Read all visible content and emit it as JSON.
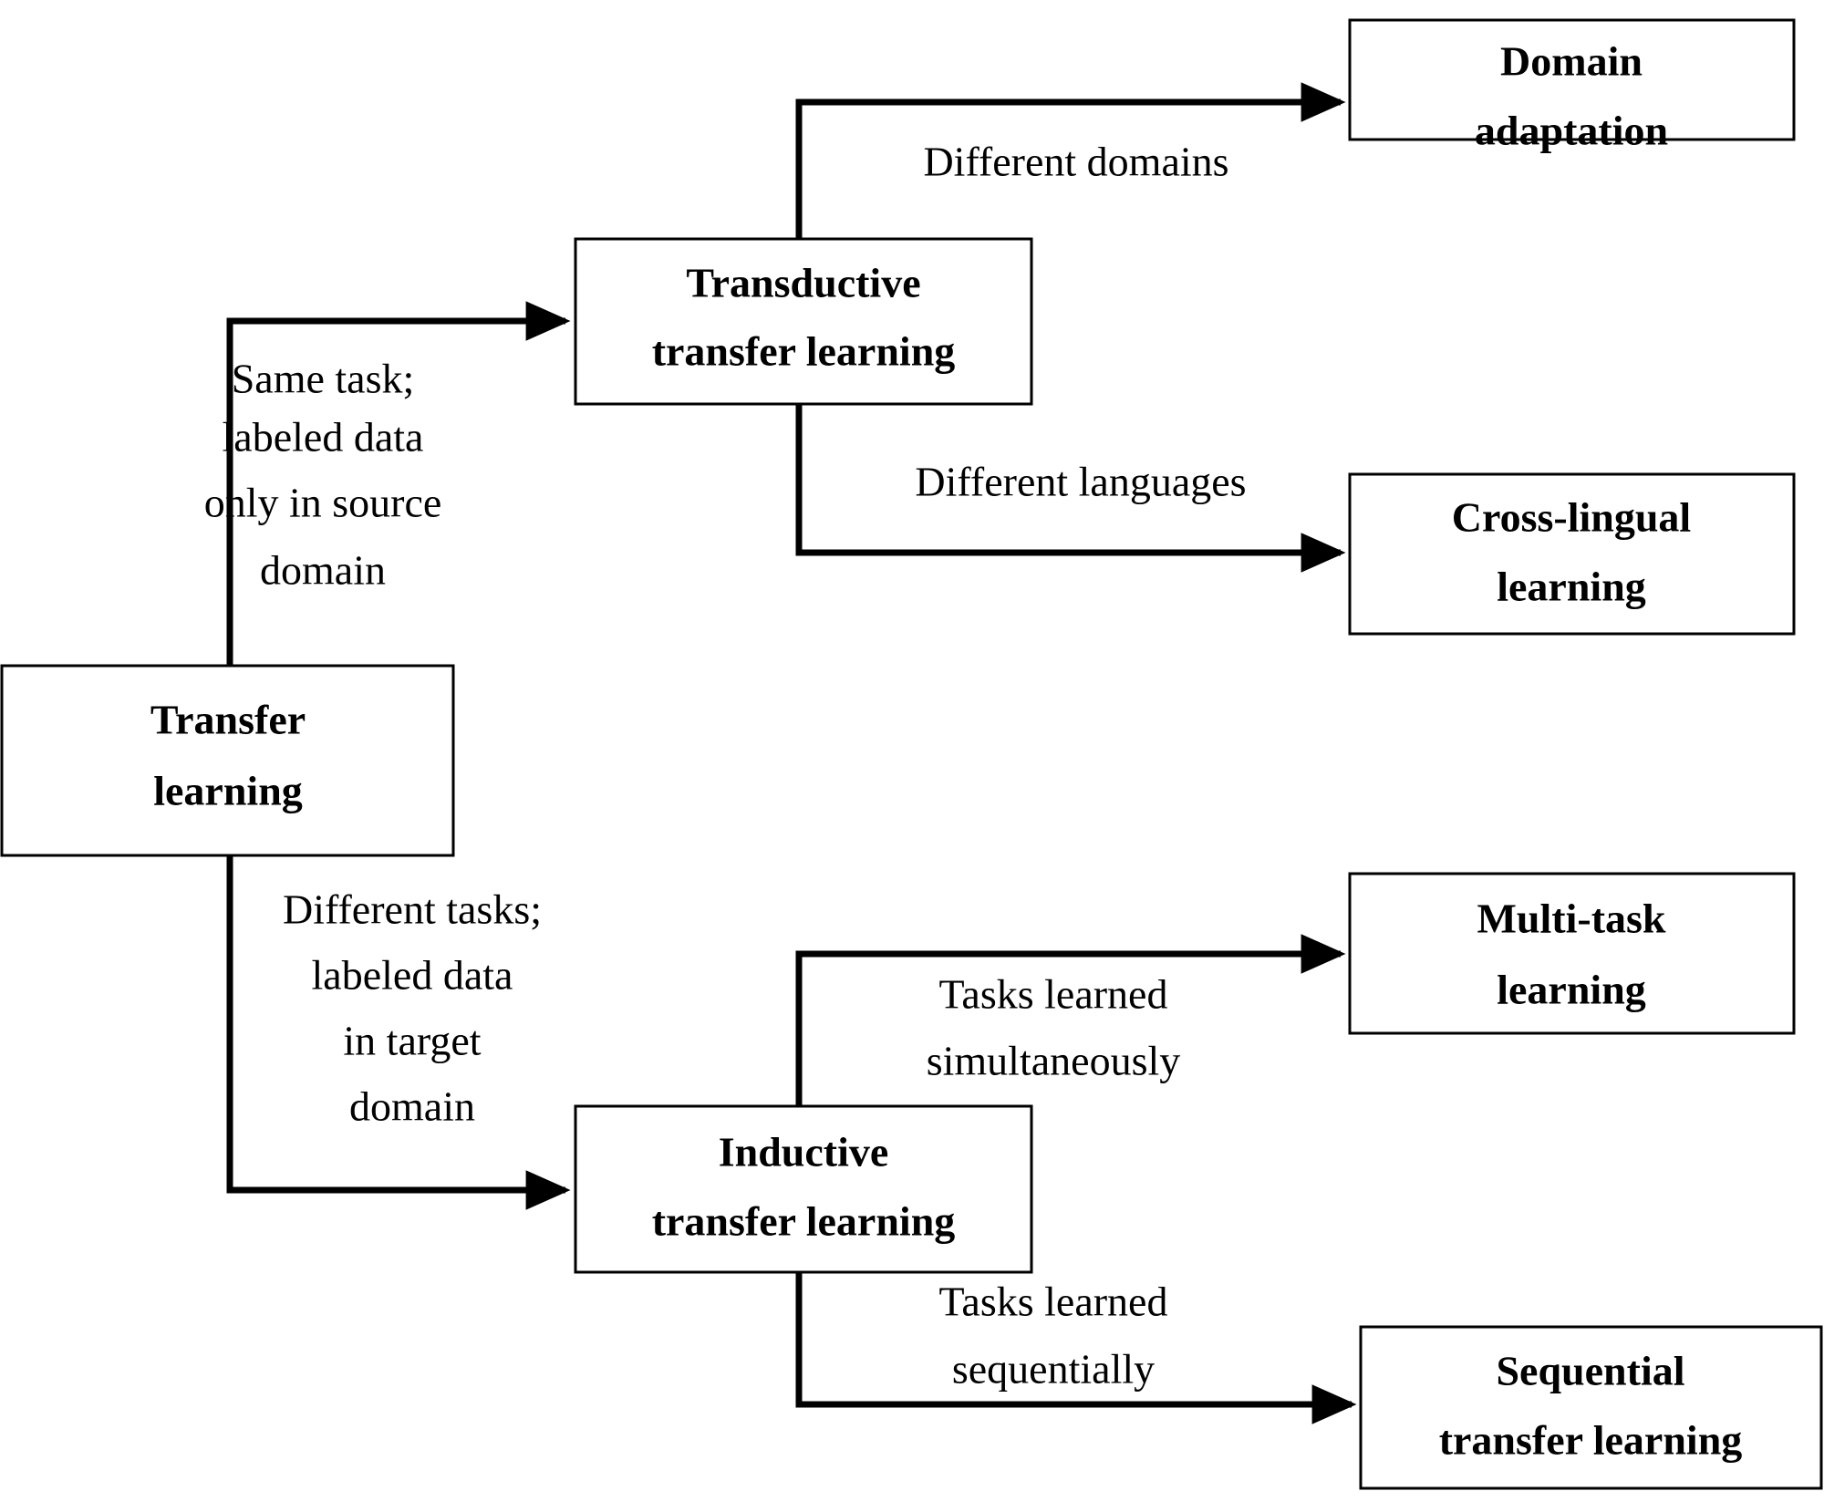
{
  "diagram": {
    "title": "Transfer learning taxonomy",
    "colors": {
      "background": "#ffffff",
      "stroke": "#000000",
      "box_fill": "#ffffff",
      "text": "#000000"
    },
    "nodes": {
      "transfer_learning": {
        "line1": "Transfer",
        "line2": "learning"
      },
      "transductive": {
        "line1": "Transductive",
        "line2": "transfer learning"
      },
      "inductive": {
        "line1": "Inductive",
        "line2": "transfer learning"
      },
      "domain_adaptation": {
        "line1": "Domain",
        "line2": "adaptation"
      },
      "cross_lingual": {
        "line1": "Cross-lingual",
        "line2": "learning"
      },
      "multi_task": {
        "line1": "Multi-task",
        "line2": "learning"
      },
      "sequential": {
        "line1": "Sequential",
        "line2": "transfer learning"
      }
    },
    "edge_labels": {
      "to_transductive": {
        "line1": "Same task;",
        "line2": "labeled data",
        "line3": "only in source",
        "line4": "domain"
      },
      "to_inductive": {
        "line1": "Different tasks;",
        "line2": "labeled data",
        "line3": "in target",
        "line4": "domain"
      },
      "to_domain_adaptation": {
        "line1": "Different domains"
      },
      "to_cross_lingual": {
        "line1": "Different languages"
      },
      "to_multi_task": {
        "line1": "Tasks learned",
        "line2": "simultaneously"
      },
      "to_sequential": {
        "line1": "Tasks learned",
        "line2": "sequentially"
      }
    }
  }
}
